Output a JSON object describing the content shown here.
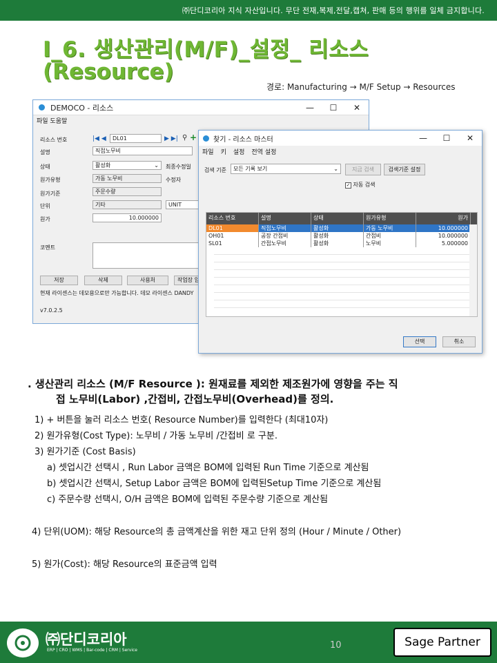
{
  "header": {
    "notice": "㈜단디코리아 지식 자산입니다. 무단 전재,복제,전달,캡쳐, 판매 등의 행위를 일체 금지합니다."
  },
  "title": {
    "line1": "I_6. 생산관리(M/F)_설정_ 리소스",
    "line2": "(Resource)"
  },
  "path": "경로:  Manufacturing → M/F Setup → Resources",
  "window1": {
    "title": "DEMOCO - 리소스",
    "menu": "파일 도움말",
    "labels": {
      "resource_no": "리소스 번호",
      "desc": "설명",
      "status": "상태",
      "cost_type": "원가유형",
      "cost_basis": "원가기준",
      "unit": "단위",
      "cost": "원가",
      "last_modified": "최종수정일",
      "modifier": "수정자",
      "comment": "코멘트"
    },
    "values": {
      "resource_no": "DL01",
      "desc": "직접노무비",
      "status": "활성화",
      "cost_type": "가동 노무비",
      "cost_basis": "주문수량",
      "unit1": "기타",
      "unit2": "UNIT",
      "cost": "10.000000"
    },
    "buttons": [
      "저장",
      "삭제",
      "사용처",
      "작업장 입"
    ],
    "license_note": "현재 라이센스는 데모용으로만 가능합니다. 데모 라이센스 DANDY",
    "version": "v7.0.2.5"
  },
  "window2": {
    "title": "찾기 - 리소스 마스터",
    "menu": [
      "파일",
      "키",
      "설정",
      "전역 설정"
    ],
    "search_label": "검색 기준",
    "search_value": "모든 기록 보기",
    "btn_search": "지금 검색",
    "btn_criteria": "검색기준 설정",
    "auto_search": "자동 검색",
    "columns": [
      "리소스 번호",
      "설명",
      "상태",
      "원가유형",
      "원가"
    ],
    "rows": [
      [
        "DL01",
        "직접노무비",
        "활성화",
        "가동 노무비",
        "10.000000"
      ],
      [
        "OH01",
        "공장 간접비",
        "활성화",
        "간접비",
        "10.000000"
      ],
      [
        "SL01",
        "간접노무비",
        "활성화",
        "노무비",
        "5.000000"
      ]
    ],
    "btn_select": "선택",
    "btn_cancel": "취소"
  },
  "content": {
    "desc_line1": ". 생산관리 리소스 (M/F Resource ): 원재료를 제외한 제조원가에 영향을 주는 직",
    "desc_line2": "접 노무비(Labor) ,간접비, 간접노무비(Overhead)를 정의.",
    "item1": "1) + 버튼을 눌러 리소스 번호( Resource Number)를 입력한다 (최대10자)",
    "item2": "2) 원가유형(Cost Type): 노무비 / 가동  노무비  /간접비 로 구분.",
    "item3": "3) 원가기준 (Cost Basis)",
    "item3a": "a) 셋업시간 선택시 , Run Labor 금액은 BOM에 입력된 Run Time 기준으로 계산됨",
    "item3b": "b) 셋업시간 선택시, Setup Labor  금액은 BOM에 입력된Setup Time 기준으로 계산됨",
    "item3c": "c) 주문수량 선택시, O/H 금액은 BOM에 입력된 주문수량 기준으로 계산됨",
    "item4": "4) 단위(UOM): 해당 Resource의 총 금액계산을 위한 재고 단위 정의 (Hour / Minute / Other)",
    "item5": "5) 원가(Cost): 해당 Resource의 표준금액 입력"
  },
  "footer": {
    "brand": "㈜단디코리아",
    "brand_sub": "ERP | CRO | WMS | Bar-code | CRM | Service",
    "page": "10",
    "partner": "Sage Partner"
  }
}
